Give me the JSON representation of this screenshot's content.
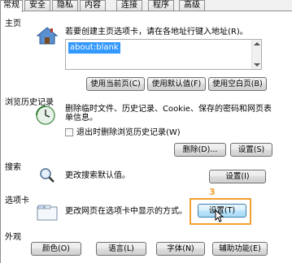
{
  "tabs": [
    "常规",
    "安全",
    "隐私",
    "内容",
    "连接",
    "程序",
    "高级"
  ],
  "home": {
    "title": "主页",
    "description": "若要创建主页选项卡，请在各地址行键入地址(R)。",
    "url_value": "about:blank",
    "buttons": [
      "使用当前页(C)",
      "使用默认值(F)",
      "使用空白页(B)"
    ]
  },
  "history": {
    "title": "浏览历史记录",
    "description": "删除临时文件、历史记录、Cookie、保存的密码和网页表单信息。",
    "checkbox_label": "退出时删除浏览历史记录(W)",
    "delete_button": "删除(D)...",
    "settings_button": "设置(S)"
  },
  "search": {
    "title": "搜索",
    "description": "更改搜索默认值。",
    "settings_button": "设置(I)"
  },
  "tabs_section": {
    "title": "选项卡",
    "description": "更改网页在选项卡中显示的方式。",
    "settings_button": "设置(T)",
    "callout_number": "3"
  },
  "appearance": {
    "title": "外观",
    "buttons": [
      "颜色(O)",
      "语言(L)",
      "字体(N)",
      "辅助功能(E)"
    ]
  },
  "colors": {
    "callout": "#f0a030",
    "selection": "#3399ff"
  }
}
